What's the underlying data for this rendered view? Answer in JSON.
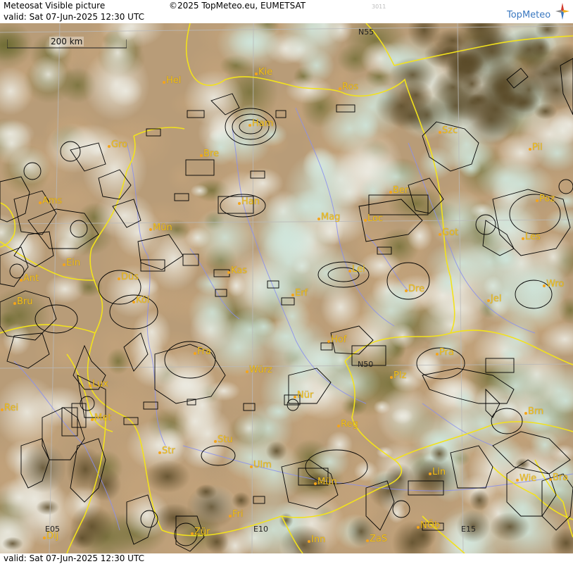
{
  "header": {
    "product": "Meteosat Visible picture",
    "valid_line": "valid:  Sat  07-Jun-2025  12:30 UTC",
    "copyright": "©2025 TopMeteo.eu, EUMETSAT",
    "code": "3011",
    "logo_text": "TopMeteo"
  },
  "footer": {
    "valid_line": "valid:  Sat  07-Jun-2025  12:30 UTC"
  },
  "scale": {
    "label": "200 km"
  },
  "grid_labels": [
    "N55",
    "N50",
    "E05",
    "E10",
    "E15"
  ],
  "cities": [
    "Hel",
    "Kie",
    "Ros",
    "Ham",
    "Szc",
    "Gro",
    "Bre",
    "Pil",
    "Ams",
    "Han",
    "Ber",
    "Poz",
    "Mün",
    "Mag",
    "Loc",
    "Got",
    "Les",
    "Ein",
    "Kas",
    "Lei",
    "Ant",
    "Düs",
    "Wro",
    "Bru",
    "Köl",
    "Erf",
    "Dre",
    "Jel",
    "Hof",
    "Fra",
    "Pra",
    "Würz",
    "Lux",
    "Plz",
    "Nür",
    "Rei",
    "Met",
    "Reg",
    "Brn",
    "Stu",
    "Str",
    "Ulm",
    "Lin",
    "Mün2",
    "Wie",
    "Bra",
    "Fri",
    "Dij",
    "Zür",
    "Inn",
    "ZaS",
    "NÖb"
  ],
  "city_labels": {
    "Hel": "Hel",
    "Kie": "Kie",
    "Ros": "Ros",
    "Ham": "Ham",
    "Szc": "Szc",
    "Gro": "Gro",
    "Bre": "Bre",
    "Pil": "Pil",
    "Ams": "Ams",
    "Han": "Han",
    "Ber": "Ber",
    "Poz": "Poz",
    "Mün": "Mün",
    "Mag": "Mag",
    "Loc": "Loc",
    "Got": "Got",
    "Les": "Les",
    "Ein": "Ein",
    "Kas": "Kas",
    "Lei": "Lei",
    "Ant": "Ant",
    "Düs": "Düs",
    "Wro": "Wro",
    "Bru": "Bru",
    "Köl": "Köl",
    "Erf": "Erf",
    "Dre": "Dre",
    "Jel": "Jel",
    "Hof": "Hof",
    "Fra": "Fra",
    "Pra": "Pra",
    "Würz": "Würz",
    "Lux": "Lux",
    "Plz": "Plz",
    "Nür": "Nür",
    "Rei": "Rei",
    "Met": "Met",
    "Reg": "Reg",
    "Brn": "Brn",
    "Stu": "Stu",
    "Str": "Str",
    "Ulm": "Ulm",
    "Lin": "Lin",
    "Mün2": "Mün",
    "Wie": "Wie",
    "Bra": "Bra",
    "Fri": "Fri",
    "Dij": "Dij",
    "Zür": "Zür",
    "Inn": "Inn",
    "ZaS": "ZaS",
    "NÖb": "NÖb"
  },
  "colors": {
    "border": "#f2e21c",
    "river": "#8a8ff0",
    "grid": "#bcbcbc",
    "city": "#f4c21a",
    "airspace": "#000000"
  }
}
